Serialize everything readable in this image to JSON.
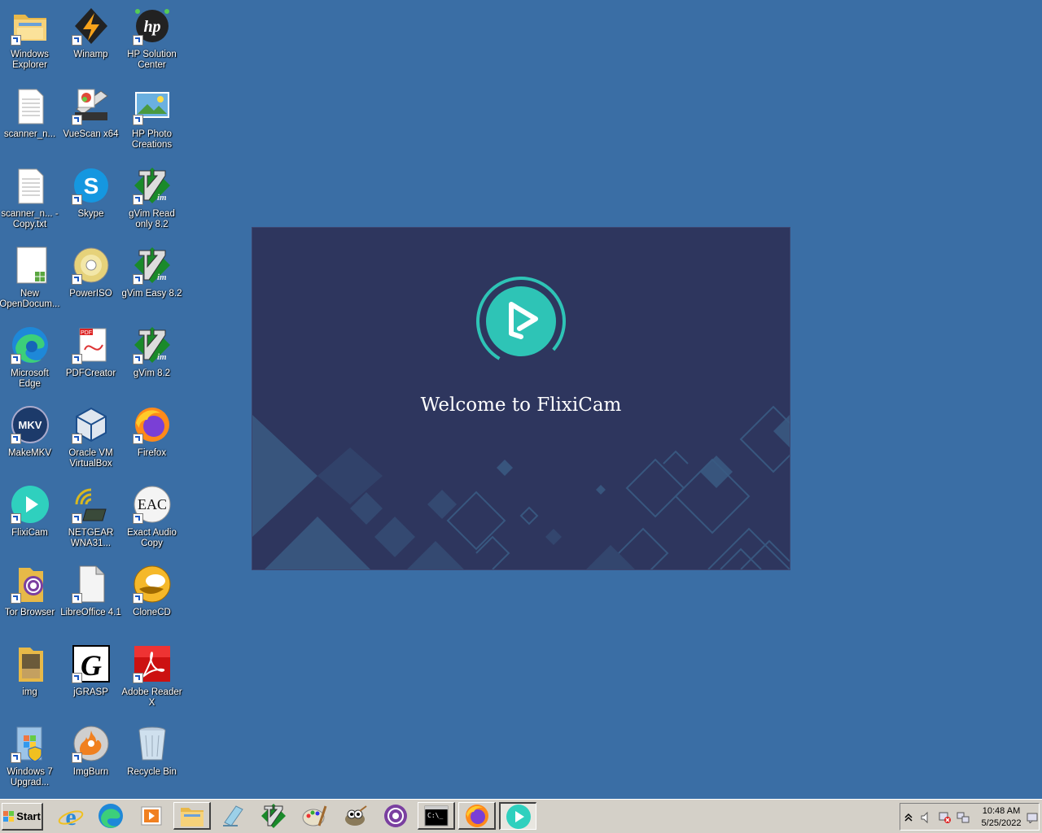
{
  "desktop": {
    "icons": [
      {
        "label": "Windows Explorer"
      },
      {
        "label": "Winamp"
      },
      {
        "label": "HP Solution Center"
      },
      {
        "label": "scanner_n..."
      },
      {
        "label": "VueScan x64"
      },
      {
        "label": "HP Photo Creations"
      },
      {
        "label": "scanner_n... - Copy.txt"
      },
      {
        "label": "Skype"
      },
      {
        "label": "gVim Read only 8.2"
      },
      {
        "label": "New OpenDocum..."
      },
      {
        "label": "PowerISO"
      },
      {
        "label": "gVim Easy 8.2"
      },
      {
        "label": "Microsoft Edge"
      },
      {
        "label": "PDFCreator"
      },
      {
        "label": "gVim 8.2"
      },
      {
        "label": "MakeMKV"
      },
      {
        "label": "Oracle VM VirtualBox"
      },
      {
        "label": "Firefox"
      },
      {
        "label": "FlixiCam"
      },
      {
        "label": "NETGEAR WNA31..."
      },
      {
        "label": "Exact Audio Copy"
      },
      {
        "label": "Tor Browser"
      },
      {
        "label": "LibreOffice 4.1"
      },
      {
        "label": "CloneCD"
      },
      {
        "label": "img"
      },
      {
        "label": "jGRASP"
      },
      {
        "label": "Adobe Reader X"
      },
      {
        "label": "Windows 7 Upgrad..."
      },
      {
        "label": "ImgBurn"
      },
      {
        "label": "Recycle Bin"
      }
    ]
  },
  "splash": {
    "title": "Welcome to FlixiCam",
    "accent": "#2ec4b6",
    "background": "#2e365e"
  },
  "taskbar": {
    "start_label": "Start",
    "items": [
      {
        "icon": "internet-explorer-icon"
      },
      {
        "icon": "edge-icon"
      },
      {
        "icon": "media-player-icon"
      },
      {
        "icon": "explorer-folder-icon"
      },
      {
        "icon": "notepad-icon"
      },
      {
        "icon": "gvim-icon"
      },
      {
        "icon": "paint-icon"
      },
      {
        "icon": "gimp-icon"
      },
      {
        "icon": "tor-icon"
      },
      {
        "icon": "cmd-icon"
      },
      {
        "icon": "firefox-icon"
      },
      {
        "icon": "flixicam-icon"
      }
    ],
    "clock": {
      "time": "10:48 AM",
      "date": "5/25/2022"
    }
  }
}
